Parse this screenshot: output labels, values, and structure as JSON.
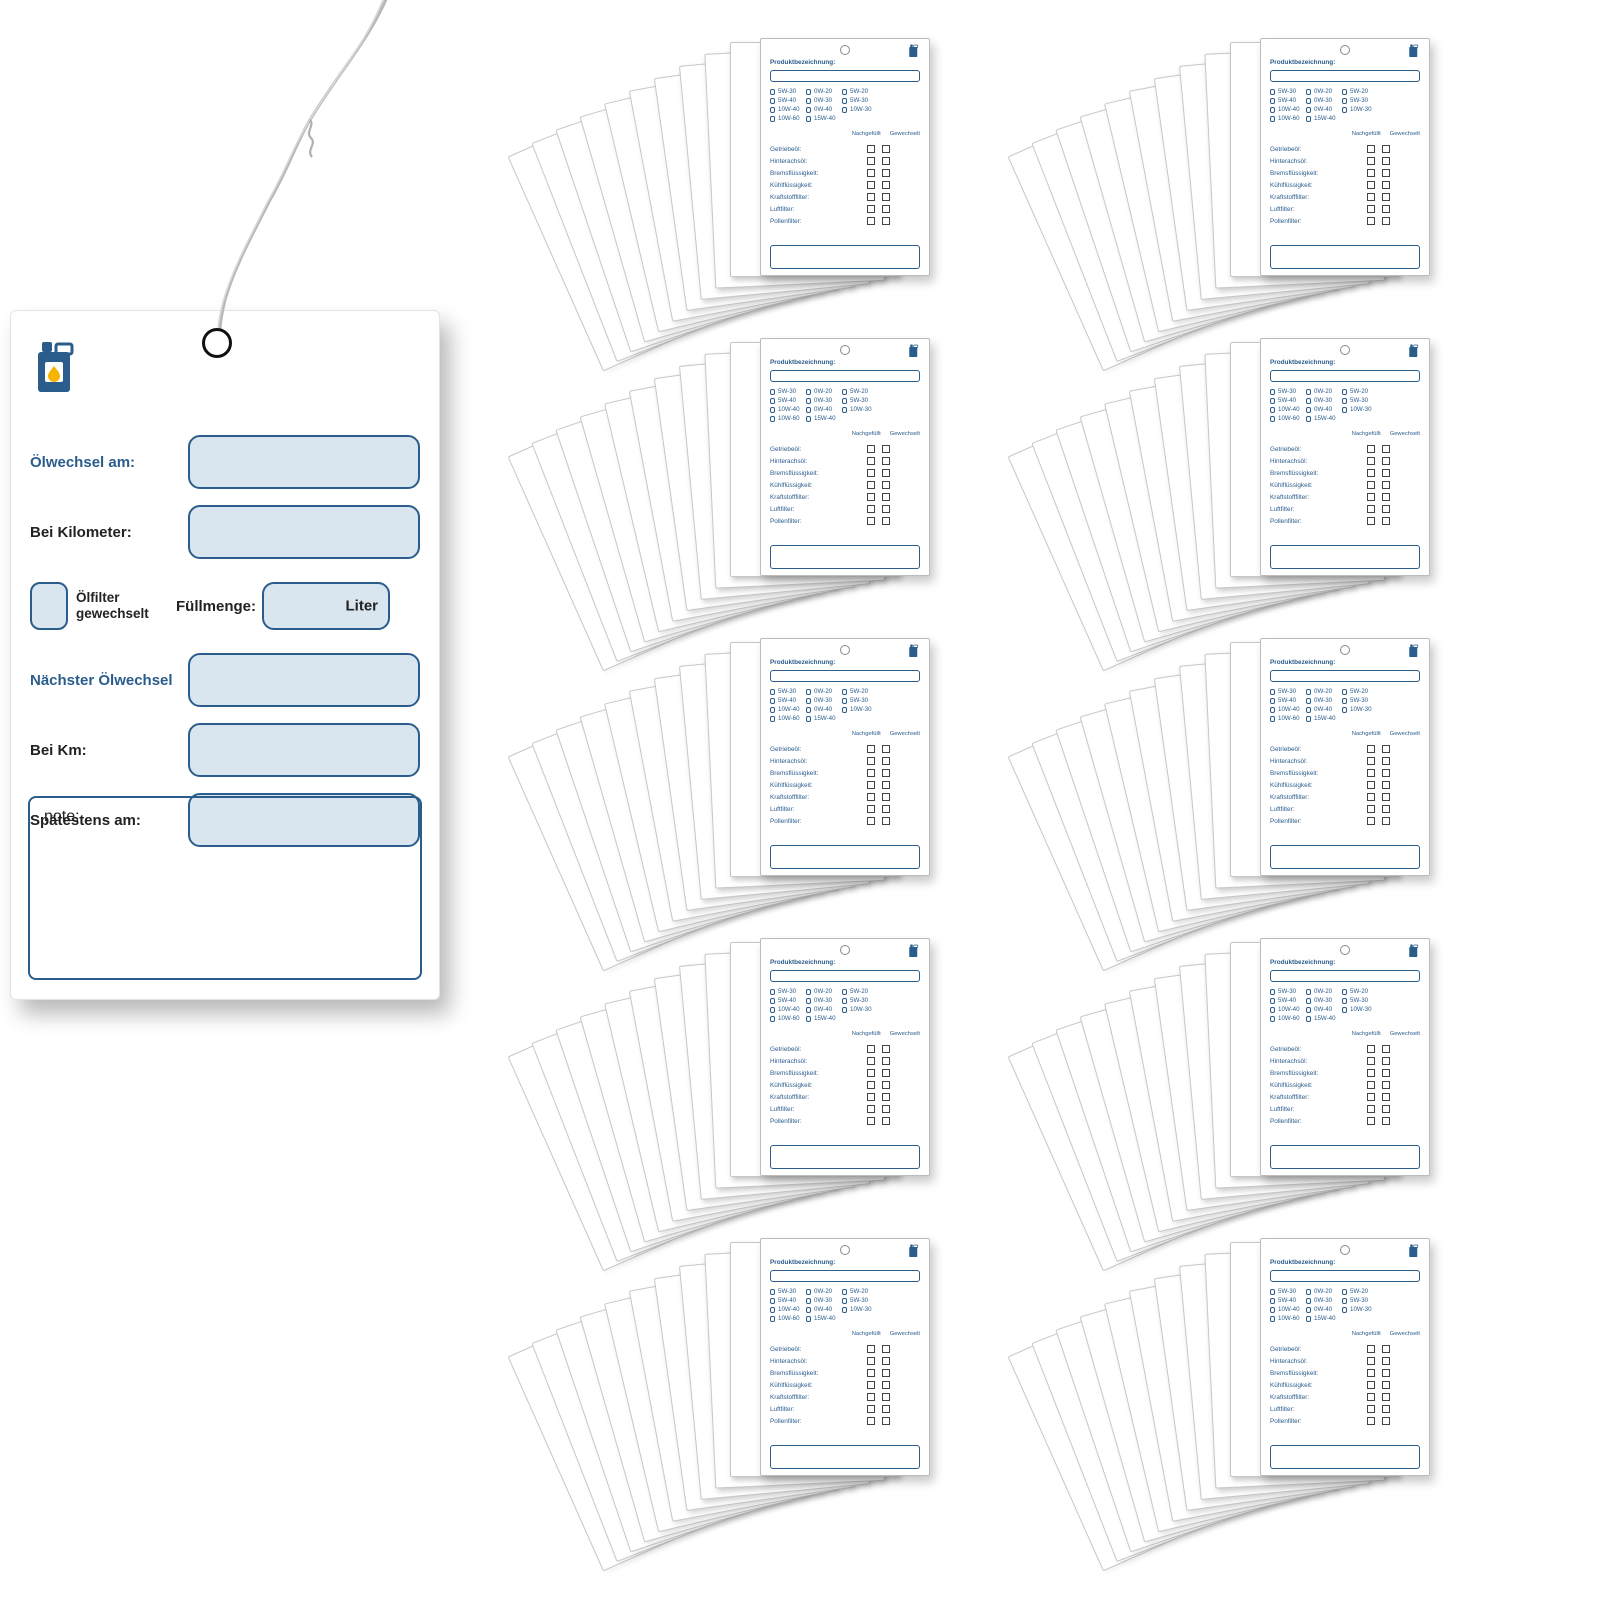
{
  "colors": {
    "blue": "#2b5d8c",
    "light": "#d9e5ef"
  },
  "front_card": {
    "icon": "oil-can-icon",
    "rows": [
      {
        "label": "Ölwechsel am:",
        "blue": true
      },
      {
        "label": "Bei Kilometer:",
        "blue": false
      }
    ],
    "filter_changed_label": "Ölfilter\ngewechselt",
    "fill_label": "Füllmenge:",
    "fill_unit": "Liter",
    "rows2": [
      {
        "label": "Nächster Ölwechsel",
        "blue": true
      },
      {
        "label": "Bei Km:",
        "blue": false
      },
      {
        "label": "Spätestens am:",
        "blue": false
      }
    ],
    "note_label": "note:"
  },
  "back_card": {
    "title": "Produktbezeichnung:",
    "grades": [
      [
        "5W-30",
        "0W-20",
        "5W-20"
      ],
      [
        "5W-40",
        "0W-30",
        "5W-30"
      ],
      [
        "10W-40",
        "0W-40",
        "10W-30"
      ],
      [
        "10W-60",
        "15W-40",
        ""
      ]
    ],
    "col_headers": [
      "Nachgefüllt",
      "Gewechselt"
    ],
    "checklist": [
      "Getriebeöl:",
      "Hinterachsöl:",
      "Bremsflüssigkeit:",
      "Kühlflüssigkeit:",
      "Kraftstofffilter:",
      "Luftfilter:",
      "Pollenfilter:"
    ]
  },
  "stack_layout": {
    "cols": 2,
    "rows": 5,
    "sheets_behind": 10
  }
}
